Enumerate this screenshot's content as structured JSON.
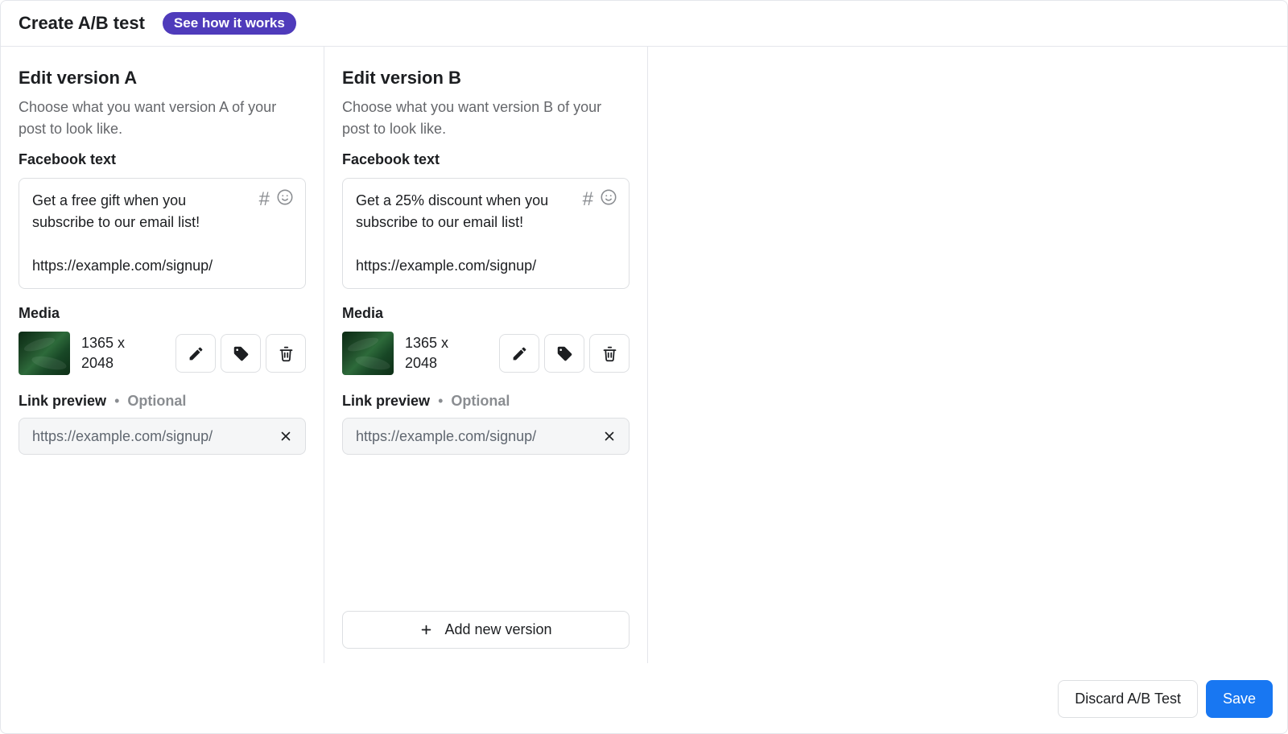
{
  "header": {
    "title": "Create A/B test",
    "badge": "See how it works"
  },
  "versions": {
    "a": {
      "title": "Edit version A",
      "desc": "Choose what you want version A of your post to look like.",
      "textLabel": "Facebook text",
      "textContent": "Get a free gift when you subscribe to our email list!\n\nhttps://example.com/signup/",
      "mediaLabel": "Media",
      "dims": "1365 x 2048",
      "linkLabel": "Link preview",
      "optional": "Optional",
      "url": "https://example.com/signup/"
    },
    "b": {
      "title": "Edit version B",
      "desc": "Choose what you want version B of your post to look like.",
      "textLabel": "Facebook text",
      "textContent": "Get a 25% discount when you subscribe to our email list!\n\nhttps://example.com/signup/",
      "mediaLabel": "Media",
      "dims": "1365 x 2048",
      "linkLabel": "Link preview",
      "optional": "Optional",
      "url": "https://example.com/signup/"
    }
  },
  "addVersion": "Add new version",
  "footer": {
    "discard": "Discard A/B Test",
    "save": "Save"
  }
}
